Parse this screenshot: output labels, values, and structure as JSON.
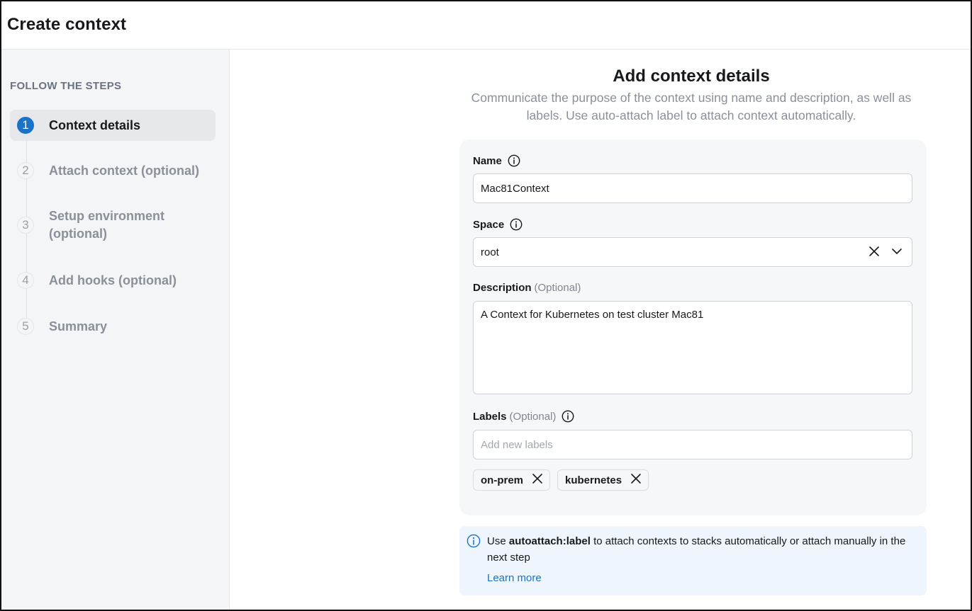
{
  "header": {
    "title": "Create context"
  },
  "sidebar": {
    "heading": "FOLLOW THE STEPS",
    "steps": [
      {
        "num": "1",
        "label": "Context details",
        "active": true
      },
      {
        "num": "2",
        "label": "Attach context (optional)"
      },
      {
        "num": "3",
        "label": "Setup environment (optional)"
      },
      {
        "num": "4",
        "label": "Add hooks (optional)"
      },
      {
        "num": "5",
        "label": "Summary"
      }
    ]
  },
  "main": {
    "title": "Add context details",
    "subtitle": "Communicate the purpose of the context using name and description, as well as labels. Use auto-attach label to attach context automatically.",
    "name": {
      "label": "Name",
      "value": "Mac81Context"
    },
    "space": {
      "label": "Space",
      "value": "root"
    },
    "description": {
      "label": "Description",
      "optional": "(Optional)",
      "value": "A Context for Kubernetes on test cluster Mac81"
    },
    "labels": {
      "label": "Labels",
      "optional": "(Optional)",
      "placeholder": "Add new labels",
      "chips": [
        "on-prem",
        "kubernetes"
      ]
    },
    "note": {
      "text_before": "Use",
      "bold": "autoattach:label",
      "text_after": "to attach contexts to stacks automatically or attach manually in the next step",
      "link": "Learn more"
    }
  },
  "colors": {
    "accent": "#1a73c8",
    "sidebar_bg": "#f4f5f7",
    "card_bg": "#f6f7f9",
    "note_bg": "#eef5fc"
  },
  "icons": [
    "info-icon",
    "clear-icon",
    "chevron-down-icon",
    "remove-chip-icon"
  ]
}
